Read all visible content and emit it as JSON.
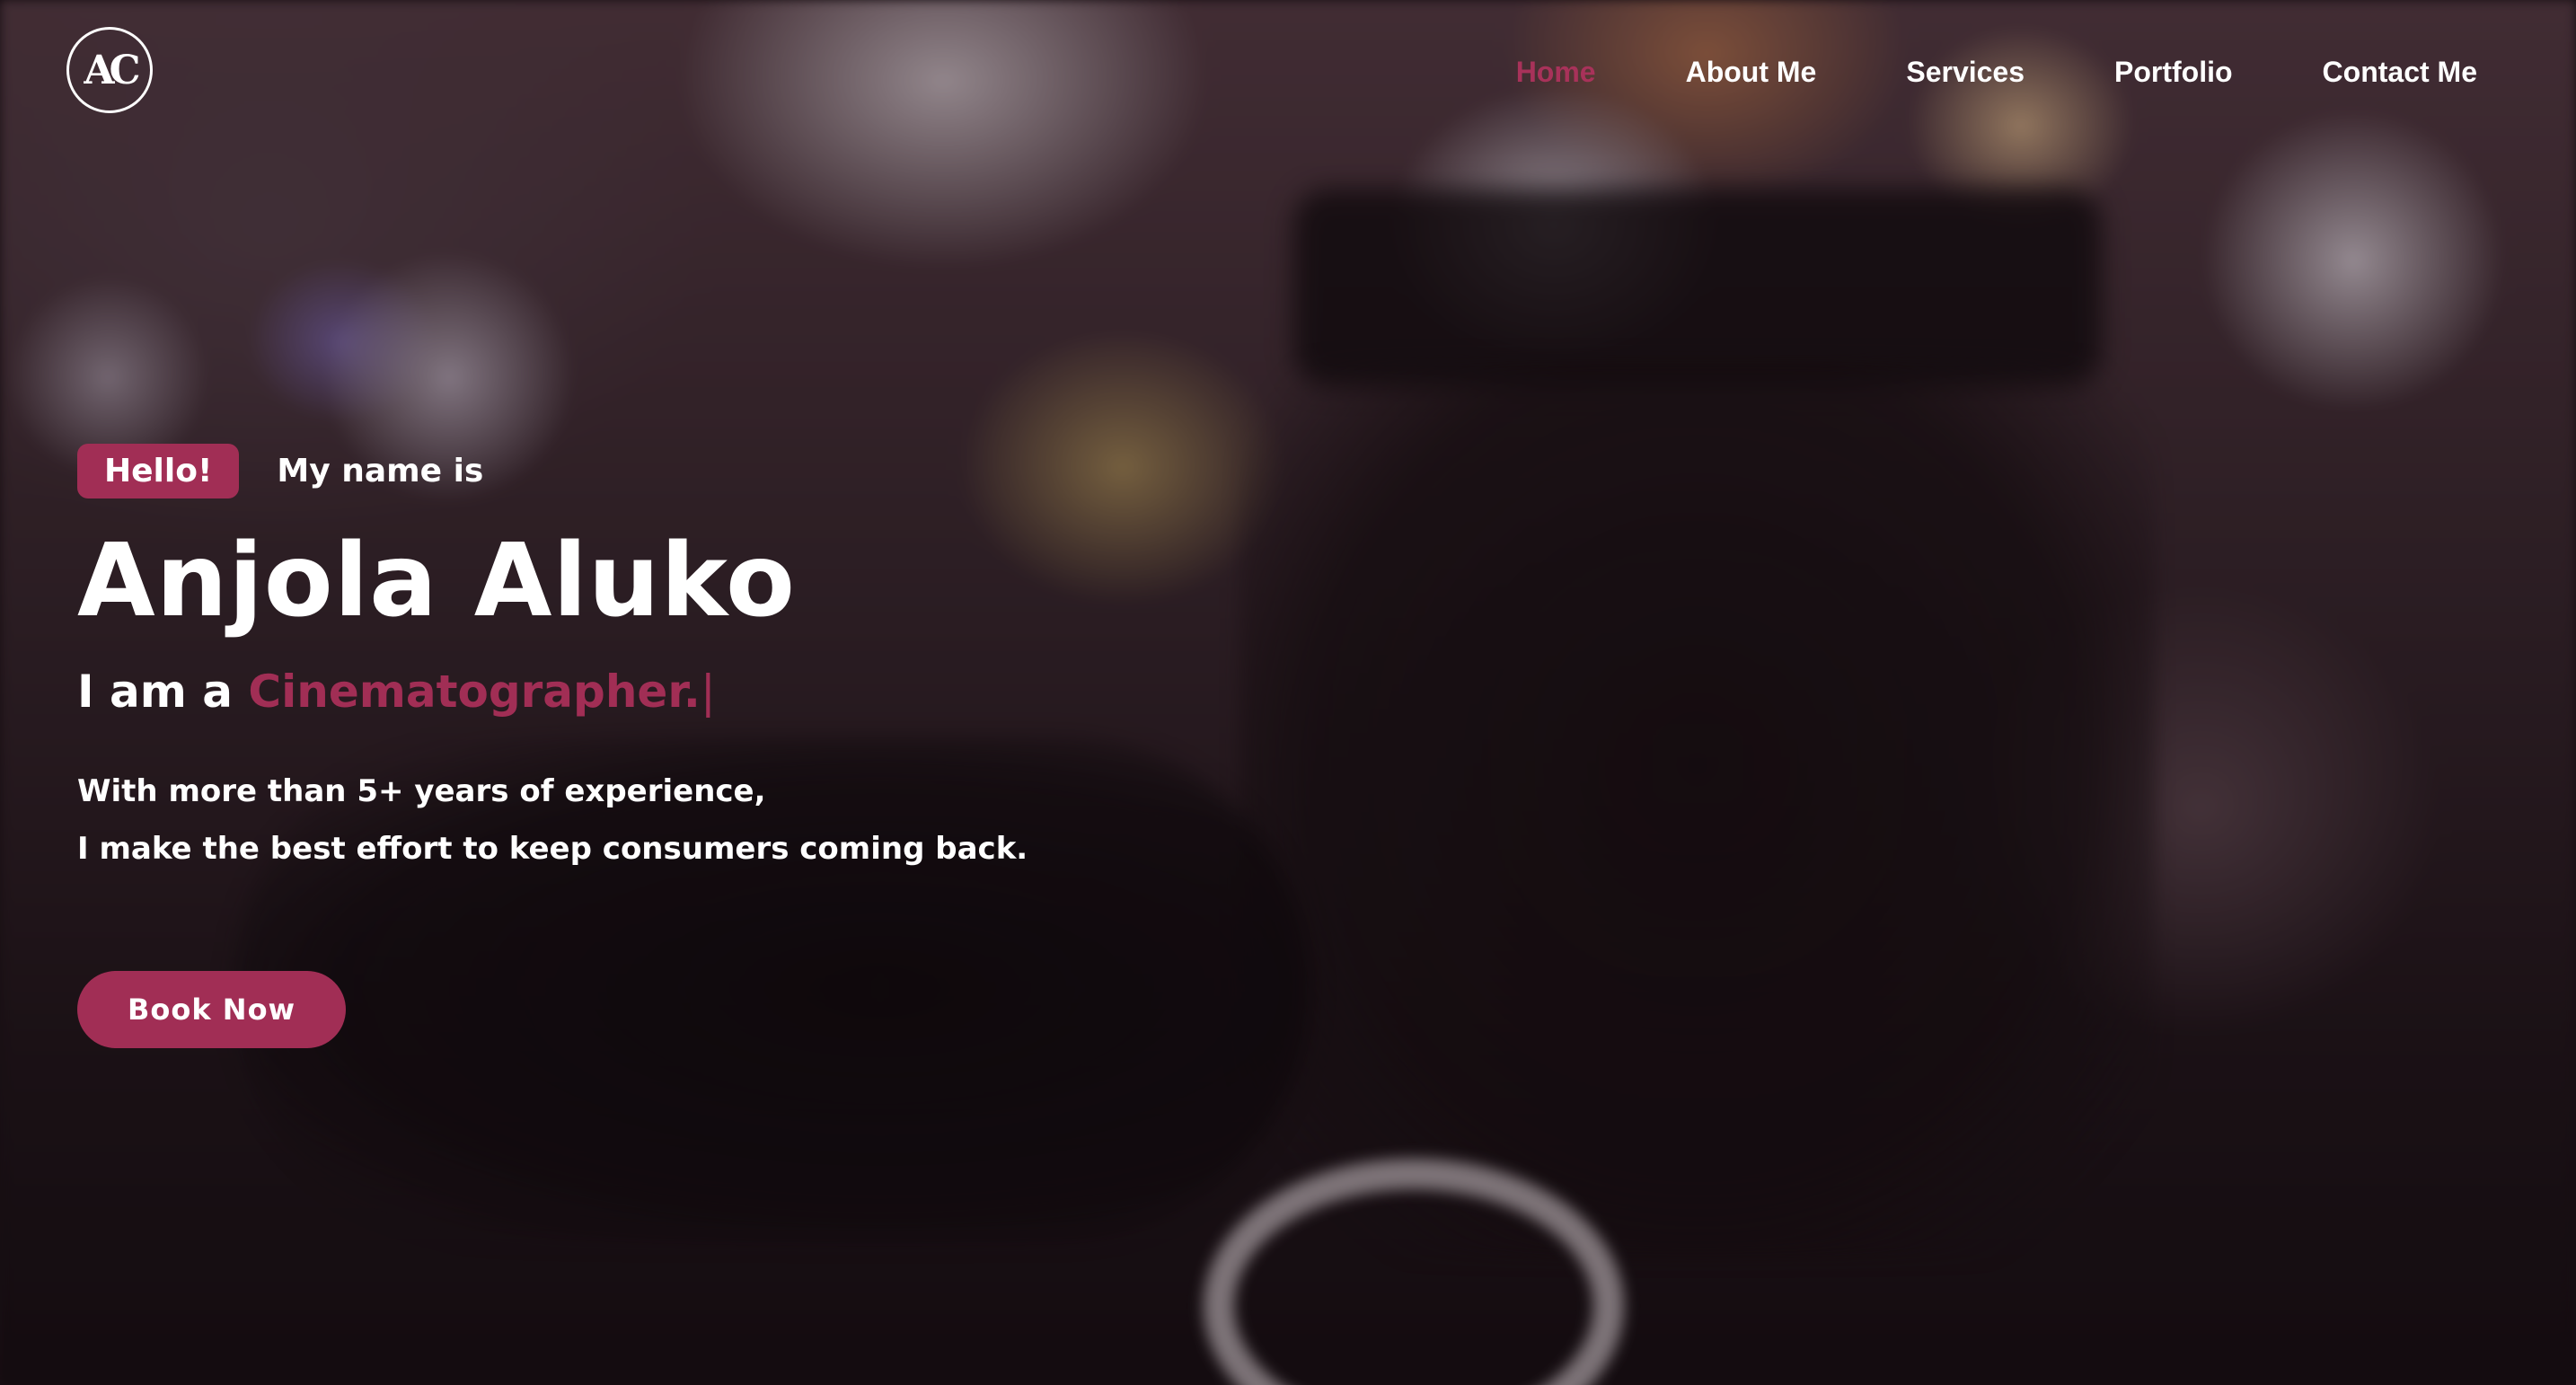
{
  "logo": {
    "text": "AC"
  },
  "nav": {
    "items": [
      {
        "label": "Home",
        "active": true
      },
      {
        "label": "About Me",
        "active": false
      },
      {
        "label": "Services",
        "active": false
      },
      {
        "label": "Portfolio",
        "active": false
      },
      {
        "label": "Contact Me",
        "active": false
      }
    ]
  },
  "hero": {
    "badge": "Hello!",
    "intro": "My name is",
    "name": "Anjola Aluko",
    "role_prefix": "I am a ",
    "role_title": "Cinematographer.",
    "role_cursor": "|",
    "description_line1": "With more than 5+ years of experience,",
    "description_line2": "I make the best effort to keep consumers coming back.",
    "cta_label": "Book Now"
  },
  "colors": {
    "accent": "#a12e55",
    "text": "#ffffff"
  }
}
